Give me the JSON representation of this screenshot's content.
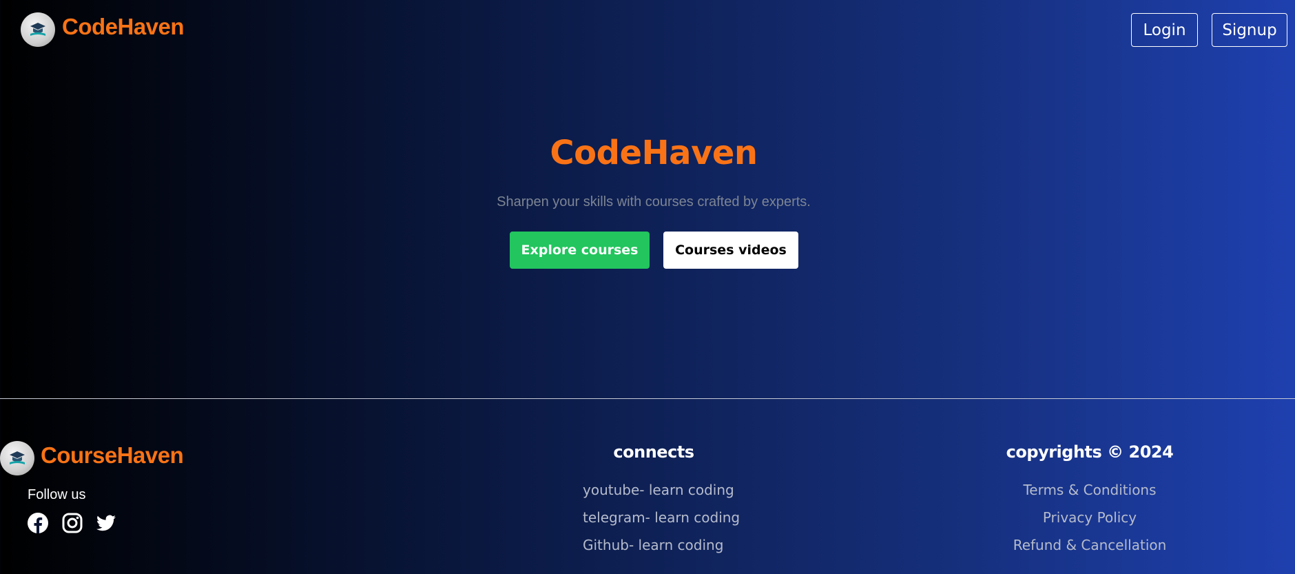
{
  "header": {
    "brand": "CodeHaven",
    "login_label": "Login",
    "signup_label": "Signup"
  },
  "hero": {
    "title": "CodeHaven",
    "subtitle": "Sharpen your skills with courses crafted by experts.",
    "primary_cta": "Explore courses",
    "secondary_cta": "Courses videos"
  },
  "footer": {
    "brand": "CourseHaven",
    "follow_label": "Follow us",
    "social": [
      "facebook-icon",
      "instagram-icon",
      "twitter-icon"
    ],
    "connects": {
      "heading": "connects",
      "links": [
        "youtube- learn coding",
        "telegram- learn coding",
        "Github- learn coding"
      ]
    },
    "legal": {
      "heading": "copyrights © 2024",
      "links": [
        "Terms & Conditions",
        "Privacy Policy",
        "Refund & Cancellation"
      ]
    }
  },
  "colors": {
    "brand_orange": "#f97316",
    "cta_green": "#22c55e",
    "bg_dark": "#000000",
    "bg_blue": "#1e40af"
  }
}
